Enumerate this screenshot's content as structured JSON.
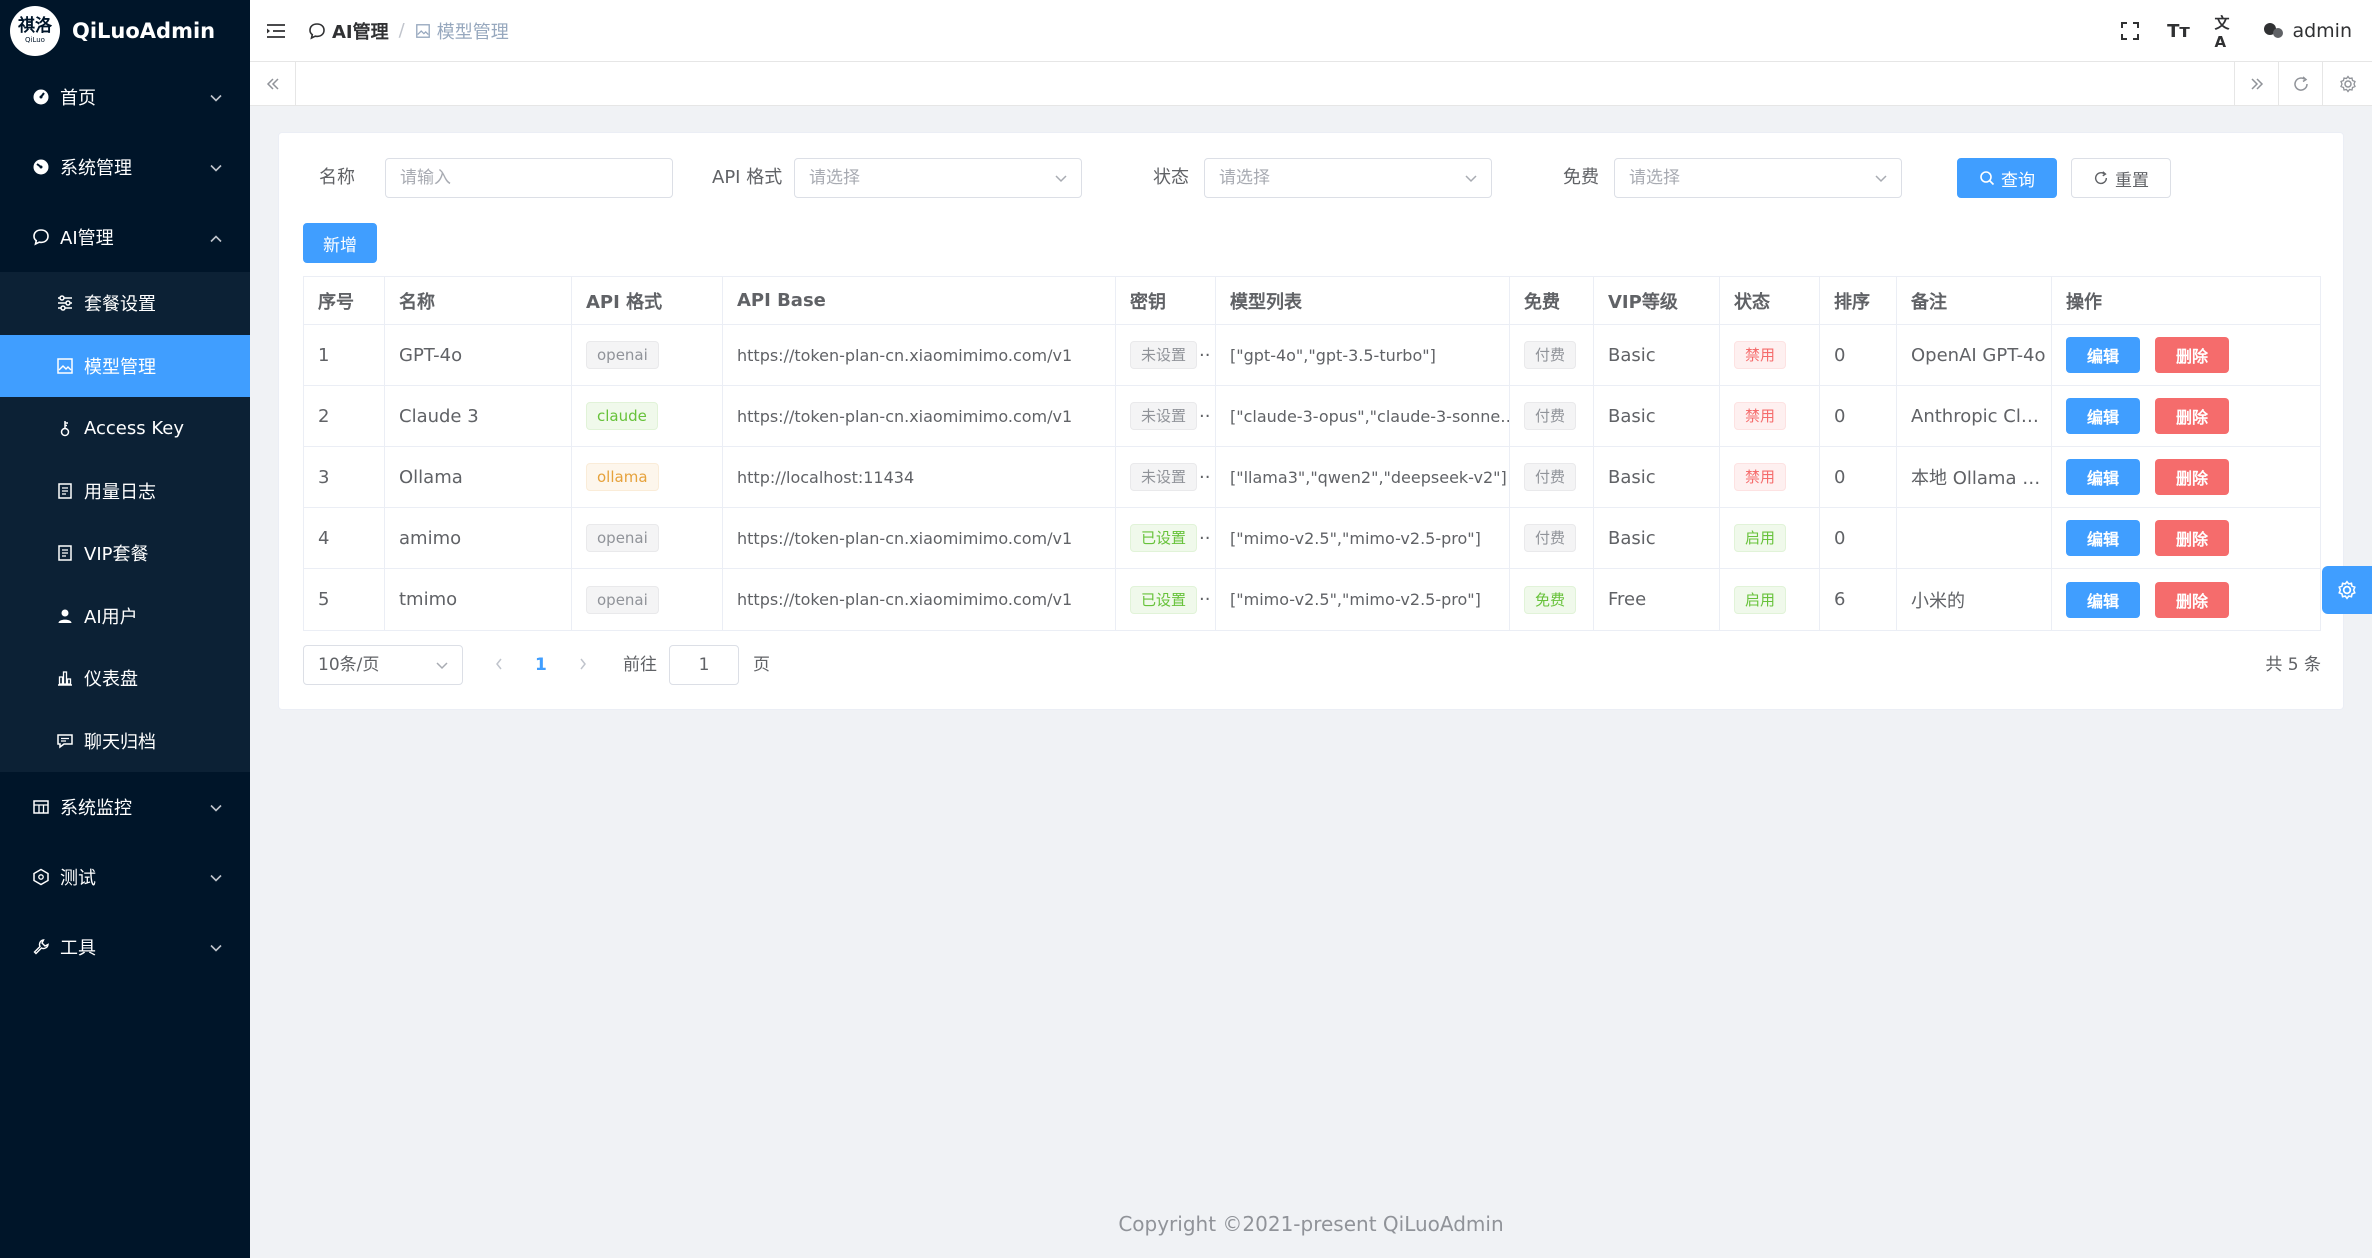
{
  "sidebar": {
    "logo_mark": "祺洛",
    "logo_small": "QiLuo",
    "app_name": "QiLuoAdmin",
    "items": [
      {
        "label": "首页"
      },
      {
        "label": "系统管理"
      },
      {
        "label": "AI管理"
      }
    ],
    "sub_items": [
      {
        "label": "套餐设置"
      },
      {
        "label": "模型管理"
      },
      {
        "label": "Access Key"
      },
      {
        "label": "用量日志"
      },
      {
        "label": "VIP套餐"
      },
      {
        "label": "AI用户"
      },
      {
        "label": "仪表盘"
      },
      {
        "label": "聊天归档"
      }
    ],
    "bottom_items": [
      {
        "label": "系统监控"
      },
      {
        "label": "测试"
      },
      {
        "label": "工具"
      }
    ]
  },
  "header": {
    "crumb_parent": "AI管理",
    "crumb_sep": "/",
    "crumb_current": "模型管理",
    "font_icon_text": "Tт",
    "translate_icon_text": "文A",
    "username": "admin"
  },
  "search": {
    "name_label": "名称",
    "name_placeholder": "请输入",
    "format_label": "API 格式",
    "format_placeholder": "请选择",
    "status_label": "状态",
    "status_placeholder": "请选择",
    "free_label": "免费",
    "free_placeholder": "请选择",
    "query_label": "查询",
    "reset_label": "重置"
  },
  "toolbar": {
    "add_label": "新增"
  },
  "table": {
    "columns": [
      "序号",
      "名称",
      "API 格式",
      "API Base",
      "密钥",
      "模型列表",
      "免费",
      "VIP等级",
      "状态",
      "排序",
      "备注",
      "操作"
    ],
    "rows": [
      {
        "idx": "1",
        "name": "GPT-4o",
        "format": "openai",
        "format_type": "info",
        "base": "https://token-plan-cn.xiaomimimo.com/v1",
        "key": "未设置",
        "key_type": "info",
        "models": "[\"gpt-4o\",\"gpt-3.5-turbo\"]",
        "free": "付费",
        "free_type": "info",
        "vip": "Basic",
        "status": "禁用",
        "status_type": "danger",
        "sort": "0",
        "remark": "OpenAI GPT-4o"
      },
      {
        "idx": "2",
        "name": "Claude 3",
        "format": "claude",
        "format_type": "success",
        "base": "https://token-plan-cn.xiaomimimo.com/v1",
        "key": "未设置",
        "key_type": "info",
        "models": "[\"claude-3-opus\",\"claude-3-sonne…",
        "free": "付费",
        "free_type": "info",
        "vip": "Basic",
        "status": "禁用",
        "status_type": "danger",
        "sort": "0",
        "remark": "Anthropic Cl…"
      },
      {
        "idx": "3",
        "name": "Ollama",
        "format": "ollama",
        "format_type": "warning",
        "base": "http://localhost:11434",
        "key": "未设置",
        "key_type": "info",
        "models": "[\"llama3\",\"qwen2\",\"deepseek-v2\"]",
        "free": "付费",
        "free_type": "info",
        "vip": "Basic",
        "status": "禁用",
        "status_type": "danger",
        "sort": "0",
        "remark": "本地 Ollama …"
      },
      {
        "idx": "4",
        "name": "amimo",
        "format": "openai",
        "format_type": "info",
        "base": "https://token-plan-cn.xiaomimimo.com/v1",
        "key": "已设置",
        "key_type": "success",
        "models": "[\"mimo-v2.5\",\"mimo-v2.5-pro\"]",
        "free": "付费",
        "free_type": "info",
        "vip": "Basic",
        "status": "启用",
        "status_type": "success",
        "sort": "0",
        "remark": ""
      },
      {
        "idx": "5",
        "name": "tmimo",
        "format": "openai",
        "format_type": "info",
        "base": "https://token-plan-cn.xiaomimimo.com/v1",
        "key": "已设置",
        "key_type": "success",
        "models": "[\"mimo-v2.5\",\"mimo-v2.5-pro\"]",
        "free": "免费",
        "free_type": "success",
        "vip": "Free",
        "status": "启用",
        "status_type": "success",
        "sort": "6",
        "remark": "小米的"
      }
    ],
    "edit_label": "编辑",
    "delete_label": "删除",
    "key_ellipsis": "··"
  },
  "pagination": {
    "page_size": "10条/页",
    "current_page": "1",
    "goto_label": "前往",
    "goto_value": "1",
    "page_suffix": "页",
    "total": "共 5 条"
  },
  "footer": {
    "copyright": "Copyright ©2021-present QiLuoAdmin"
  },
  "colors": {
    "primary": "#409eff",
    "danger": "#f56c6c",
    "sidebar_bg": "#001529"
  }
}
